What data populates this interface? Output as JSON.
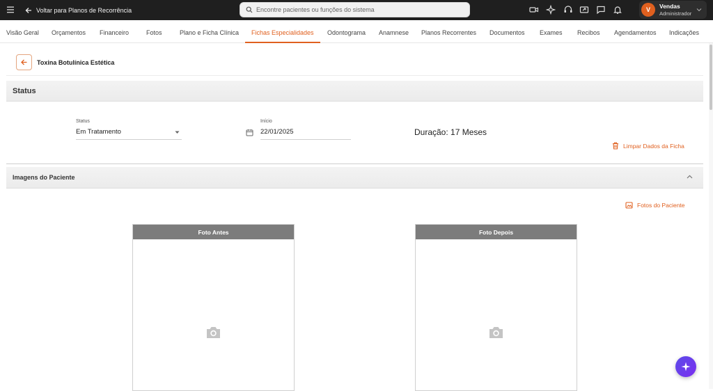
{
  "topbar": {
    "back_label": "Voltar para Planos de Recorrência",
    "search_placeholder": "Encontre pacientes ou funções do sistema",
    "icons": [
      "video-icon",
      "sparkle-icon",
      "headset-icon",
      "screen-share-icon",
      "chat-icon",
      "bell-icon"
    ],
    "user": {
      "initial": "V",
      "name": "Vendas",
      "role": "Administrador"
    }
  },
  "tabs": [
    {
      "label": "Visão Geral",
      "active": false
    },
    {
      "label": "Orçamentos",
      "active": false
    },
    {
      "label": "Financeiro",
      "active": false
    },
    {
      "label": "Fotos",
      "active": false
    },
    {
      "label": "Plano e Ficha Clínica",
      "active": false
    },
    {
      "label": "Fichas Especialidades",
      "active": true
    },
    {
      "label": "Odontograma",
      "active": false
    },
    {
      "label": "Anamnese",
      "active": false
    },
    {
      "label": "Planos Recorrentes",
      "active": false
    },
    {
      "label": "Documentos",
      "active": false
    },
    {
      "label": "Exames",
      "active": false
    },
    {
      "label": "Recibos",
      "active": false
    },
    {
      "label": "Agendamentos",
      "active": false
    },
    {
      "label": "Indicações",
      "active": false
    }
  ],
  "page": {
    "title": "Toxina Botulínica Estética"
  },
  "status_section": {
    "title": "Status",
    "status_label": "Status",
    "status_value": "Em Tratamento",
    "inicio_label": "Início",
    "inicio_value": "22/01/2025",
    "duracao": "Duração: 17 Meses",
    "clear_label": "Limpar Dados da Ficha"
  },
  "images_section": {
    "title": "Imagens do Paciente",
    "photos_link": "Fotos do Paciente",
    "before_label": "Foto Antes",
    "after_label": "Foto Depois"
  },
  "colors": {
    "accent": "#e0601f",
    "topbar": "#1f1f1f",
    "fab": "#6a3ef0"
  }
}
